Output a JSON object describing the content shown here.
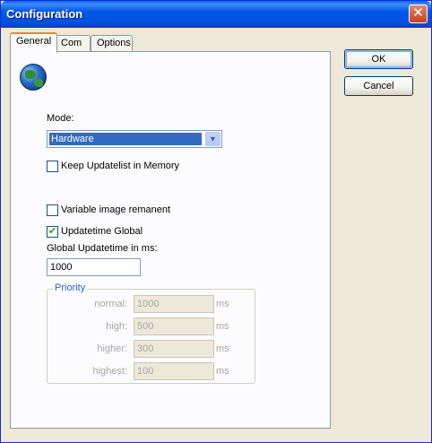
{
  "window": {
    "title": "Configuration",
    "close_glyph": "✕"
  },
  "tabs": [
    {
      "label": "General",
      "active": true
    },
    {
      "label": "Com",
      "active": false
    },
    {
      "label": "Options",
      "active": false
    }
  ],
  "general": {
    "icon": "globe-icon",
    "mode_label": "Mode:",
    "mode_value": "Hardware",
    "keep_updatelist": {
      "label": "Keep Updatelist in Memory",
      "checked": false
    },
    "variable_image": {
      "label": "Variable image remanent",
      "checked": false
    },
    "updatetime_global": {
      "label": "Updatetime Global",
      "checked": true,
      "mark": "✔"
    },
    "global_updatetime_label": "Global Updatetime in ms:",
    "global_updatetime_value": "1000",
    "priority": {
      "title": "Priority",
      "unit": "ms",
      "rows": [
        {
          "label": "normal:",
          "value": "1000"
        },
        {
          "label": "high:",
          "value": "500"
        },
        {
          "label": "higher:",
          "value": "300"
        },
        {
          "label": "highest:",
          "value": "100"
        }
      ]
    }
  },
  "buttons": {
    "ok": "OK",
    "cancel": "Cancel"
  }
}
